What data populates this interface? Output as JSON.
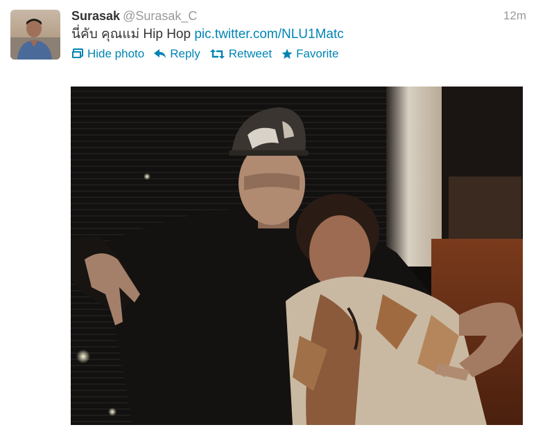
{
  "tweet": {
    "fullname": "Surasak",
    "handle": "@Surasak_C",
    "timestamp": "12m",
    "text": "นี่คับ คุณแม่ Hip Hop ",
    "link": "pic.twitter.com/NLU1Matc"
  },
  "actions": {
    "hide_photo": "Hide photo",
    "reply": "Reply",
    "retweet": "Retweet",
    "favorite": "Favorite"
  },
  "colors": {
    "link": "#0084b4",
    "name": "#333333",
    "muted": "#999999"
  },
  "icons": {
    "hide_photo": "photo-icon",
    "reply": "reply-arrow-icon",
    "retweet": "retweet-icon",
    "favorite": "star-icon"
  }
}
